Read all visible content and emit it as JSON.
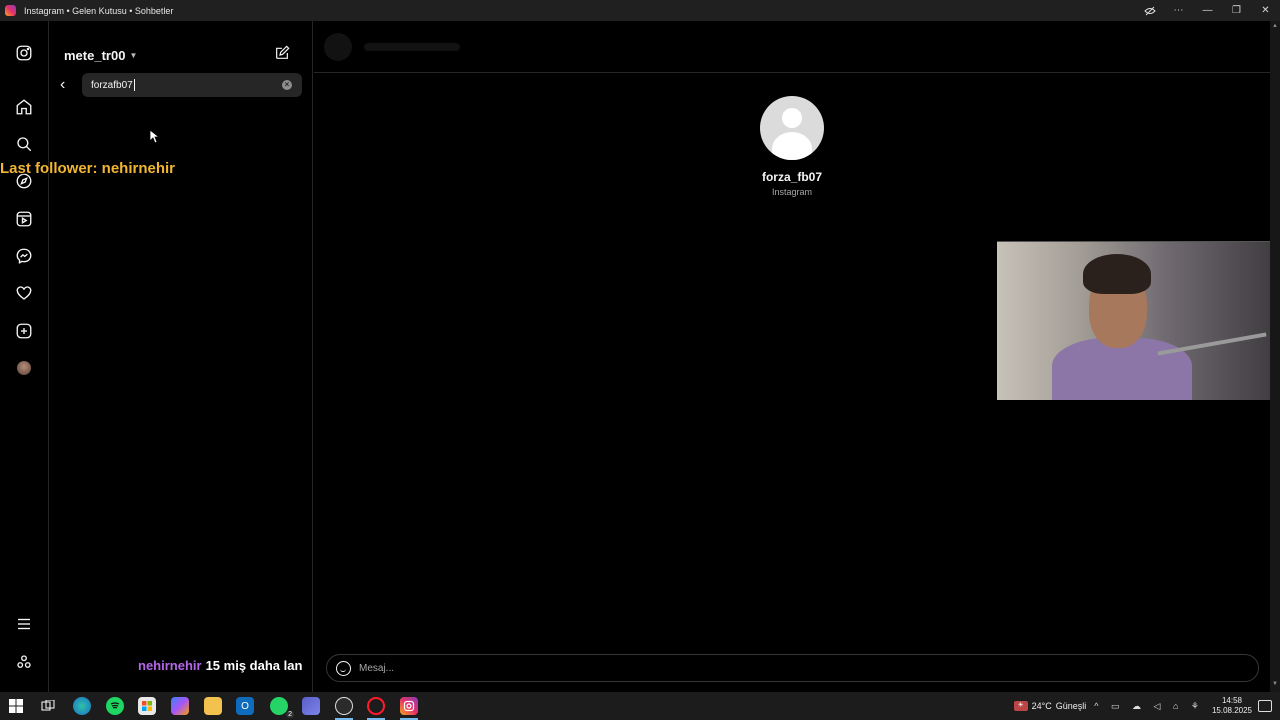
{
  "window": {
    "title": "Instagram • Gelen Kutusu • Sohbetler",
    "controls": [
      "hide-icon",
      "more-icon",
      "minimize-icon",
      "restore-icon",
      "close-icon"
    ]
  },
  "rail": {
    "items": [
      "instagram-logo-icon",
      "home-icon",
      "search-icon",
      "explore-icon",
      "reels-icon",
      "messenger-icon",
      "heart-icon",
      "create-icon",
      "profile-avatar",
      "menu-icon",
      "threads-icon"
    ]
  },
  "inbox": {
    "username": "mete_tr00",
    "search_value": "forzafb07"
  },
  "overlays": {
    "last_follower": "Last follower: nehirnehir",
    "chat_user": "nehirnehir",
    "chat_message": "15 miş daha lan"
  },
  "chat": {
    "profile_name": "forza_fb07",
    "profile_sub": "Instagram",
    "composer_placeholder": "Mesaj..."
  },
  "taskbar": {
    "weather_temp": "24°C",
    "weather_desc": "Güneşli",
    "time": "14:58",
    "date": "15.08.2025",
    "apps": [
      "windows-start-icon",
      "task-view-icon",
      "edge-icon",
      "spotify-icon",
      "store-icon",
      "copilot-icon",
      "file-explorer-icon",
      "outlook-icon",
      "whatsapp-icon",
      "teams-icon",
      "chatgpt-icon",
      "opera-icon",
      "instagram-icon"
    ],
    "whatsapp_badge": "2"
  }
}
